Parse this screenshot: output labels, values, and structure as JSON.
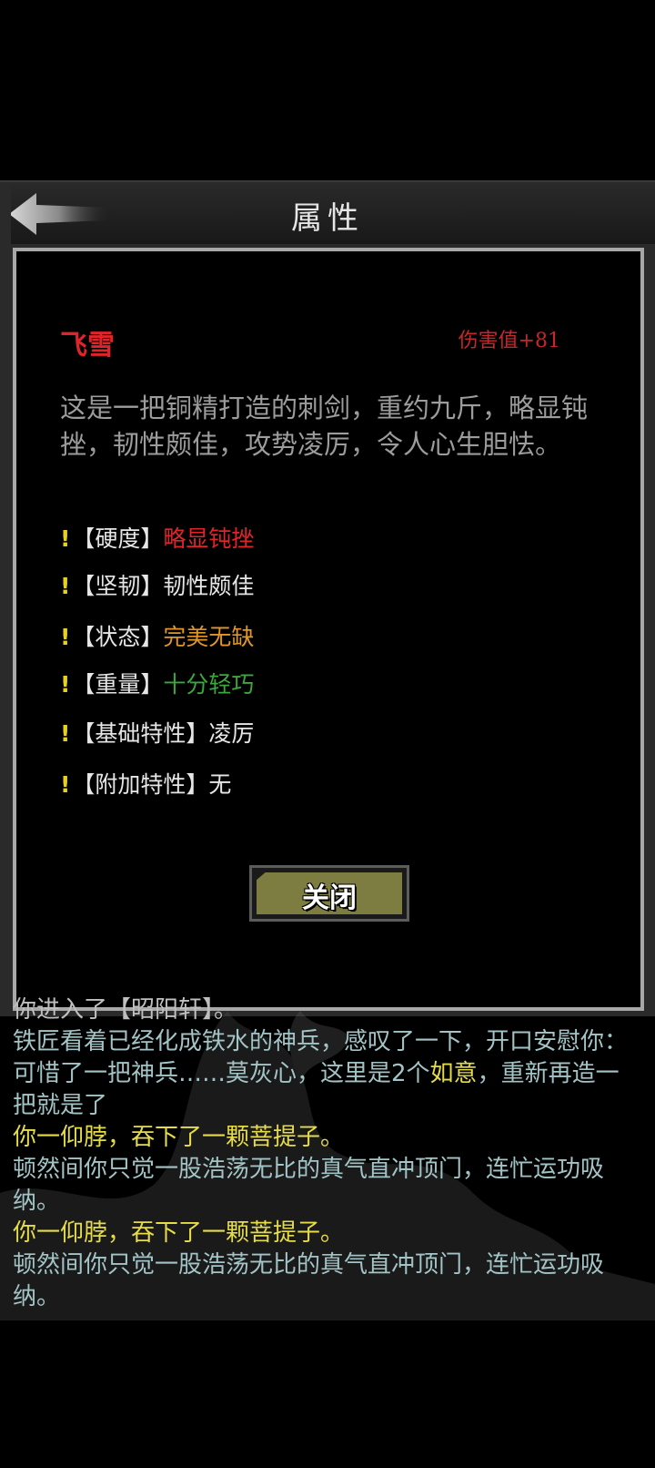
{
  "header": {
    "title": "属性"
  },
  "item": {
    "name": "飞雪",
    "damage": "伤害值+81",
    "description": "这是一把铜精打造的刺剑，重约九斤，略显钝挫，韧性颇佳，攻势凌厉，令人心生胆怯。"
  },
  "attributes": [
    {
      "key": "【硬度】",
      "value": "略显钝挫",
      "color": "#e0242a"
    },
    {
      "key": "【坚韧】",
      "value": "韧性颇佳",
      "color": "#e6e6e6"
    },
    {
      "key": "【状态】",
      "value": "完美无缺",
      "color": "#e0962a"
    },
    {
      "key": "【重量】",
      "value": "十分轻巧",
      "color": "#3aa83a"
    },
    {
      "key": "【基础特性】",
      "value": "凌厉",
      "color": "#e6e6e6"
    },
    {
      "key": "【附加特性】",
      "value": "无",
      "color": "#e6e6e6"
    }
  ],
  "close_button": {
    "label": "关闭"
  },
  "log": [
    {
      "text": "你进入了【昭阳轩】。",
      "color": "#bfbfbf"
    },
    {
      "text": "铁匠看着已经化成铁水的神兵，感叹了一下，开口安慰你：可惜了一把神兵……莫灰心，这里是2个",
      "highlight": "如意",
      "after": "，重新再造一把就是了",
      "color": "#a3c4c6",
      "highlight_color": "#e6dc4a"
    },
    {
      "text": "你一仰脖，吞下了一颗菩提子。",
      "color": "#e6dc4a"
    },
    {
      "text": "顿然间你只觉一股浩荡无比的真气直冲顶门，连忙运功吸纳。",
      "color": "#a3c4c6"
    },
    {
      "text": "你一仰脖，吞下了一颗菩提子。",
      "color": "#e6dc4a"
    },
    {
      "text": "顿然间你只觉一股浩荡无比的真气直冲顶门，连忙运功吸纳。",
      "color": "#a3c4c6"
    }
  ],
  "icons": {
    "back": "back-arrow-icon",
    "attribute_marker": "exclamation-icon"
  }
}
